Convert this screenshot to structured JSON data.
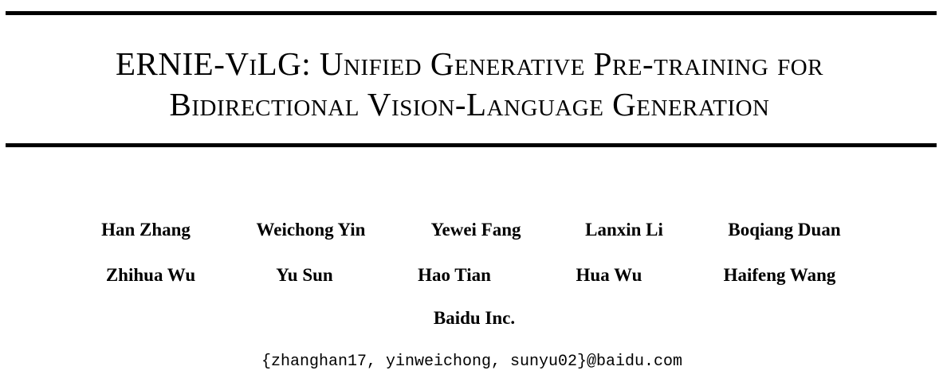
{
  "paper": {
    "title_line1": "ERNIE-ViLG: Unified Generative Pre-training for",
    "title_line2": "Bidirectional Vision-Language Generation",
    "authors_row1": [
      "Han Zhang",
      "Weichong Yin",
      "Yewei Fang",
      "Lanxin Li",
      "Boqiang Duan"
    ],
    "authors_row2": [
      "Zhihua Wu",
      "Yu Sun",
      "Hao Tian",
      "Hua Wu",
      "Haifeng Wang"
    ],
    "affiliation": "Baidu Inc.",
    "email": "{zhanghan17, yinweichong, sunyu02}@baidu.com"
  }
}
